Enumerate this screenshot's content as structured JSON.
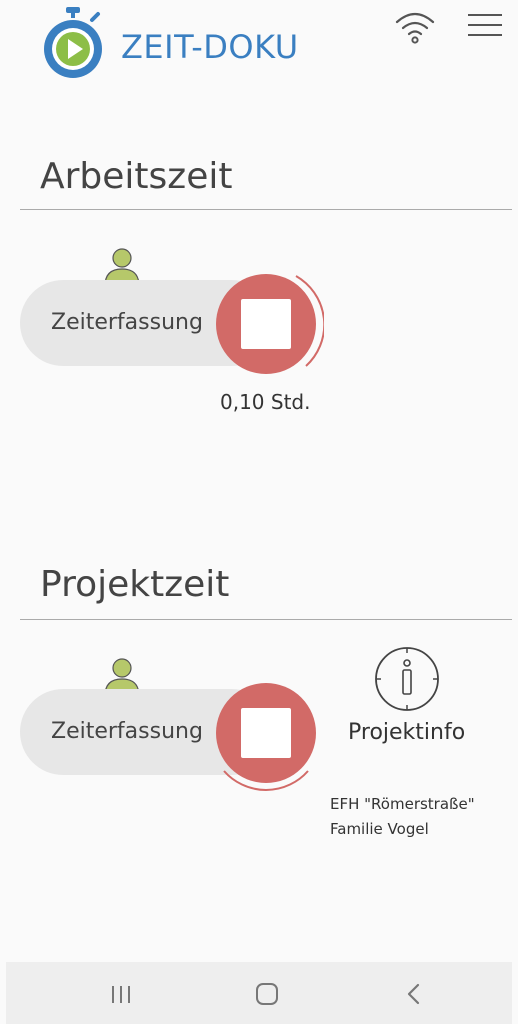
{
  "header": {
    "app_name": "ZEIT-DOKU",
    "logo_icon": "stopwatch-play-icon",
    "wifi_icon": "wifi-icon",
    "menu_icon": "hamburger-menu-icon",
    "brand_color": "#3a7fc1",
    "accent_green": "#8dbe47"
  },
  "arbeitszeit": {
    "title": "Arbeitszeit",
    "pill_label": "Zeiterfassung",
    "user_icon": "person-icon",
    "stop_icon": "stop-icon",
    "duration": "0,10 Std."
  },
  "projektzeit": {
    "title": "Projektzeit",
    "pill_label": "Zeiterfassung",
    "user_icon": "person-icon",
    "stop_icon": "stop-icon",
    "info_icon": "info-icon",
    "info_label": "Projektinfo",
    "project_name": "EFH \"Römerstraße\"",
    "project_client": "Familie Vogel"
  },
  "colors": {
    "stop_red": "#d26a67",
    "person_green": "#b6c86a",
    "pill_gray": "#e7e7e7"
  },
  "navigation": {
    "recent_icon": "recent-apps-icon",
    "home_icon": "home-icon",
    "back_icon": "back-icon"
  }
}
